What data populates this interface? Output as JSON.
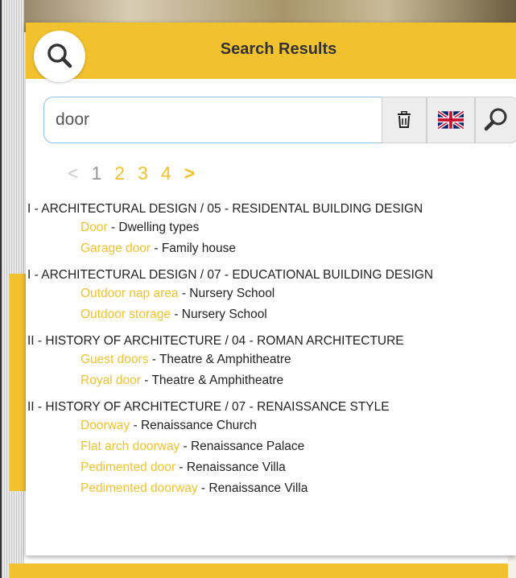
{
  "header": {
    "title": "Search Results"
  },
  "search": {
    "value": "door"
  },
  "pagination": {
    "prev": "<",
    "pages": [
      {
        "label": "1",
        "current": true
      },
      {
        "label": "2",
        "current": false
      },
      {
        "label": "3",
        "current": false
      },
      {
        "label": "4",
        "current": false
      }
    ],
    "next": ">"
  },
  "results": [
    {
      "title": "I - ARCHITECTURAL DESIGN / 05 - RESIDENTAL BUILDING DESIGN",
      "items": [
        {
          "term": "Door",
          "sep": " - ",
          "section": "Dwelling types"
        },
        {
          "term": "Garage door",
          "sep": " - ",
          "section": "Family house"
        }
      ]
    },
    {
      "title": "I - ARCHITECTURAL DESIGN / 07 - EDUCATIONAL BUILDING DESIGN",
      "items": [
        {
          "term": "Outdoor nap area",
          "sep": " - ",
          "section": "Nursery School"
        },
        {
          "term": "Outdoor storage",
          "sep": " - ",
          "section": "Nursery School"
        }
      ]
    },
    {
      "title": "II - HISTORY OF ARCHITECTURE / 04 - ROMAN ARCHITECTURE",
      "items": [
        {
          "term": "Guest doors",
          "sep": " - ",
          "section": "Theatre & Amphitheatre"
        },
        {
          "term": "Royal door",
          "sep": " - ",
          "section": "Theatre & Amphitheatre"
        }
      ]
    },
    {
      "title": "II - HISTORY OF ARCHITECTURE / 07 - RENAISSANCE STYLE",
      "items": [
        {
          "term": "Doorway",
          "sep": " - ",
          "section": "Renaissance Church"
        },
        {
          "term": "Flat arch doorway",
          "sep": " - ",
          "section": "Renaissance Palace"
        },
        {
          "term": "Pedimented door",
          "sep": " - ",
          "section": "Renaissance Villa"
        },
        {
          "term": "Pedimented doorway",
          "sep": " - ",
          "section": "Renaissance Villa"
        }
      ]
    }
  ],
  "colors": {
    "accent": "#f2c12e",
    "input_border": "#8fc0e6",
    "text": "#222222"
  },
  "icons": {
    "header": "search-icon",
    "clear": "trash-icon",
    "language": "uk-flag-icon",
    "submit": "search-icon"
  }
}
